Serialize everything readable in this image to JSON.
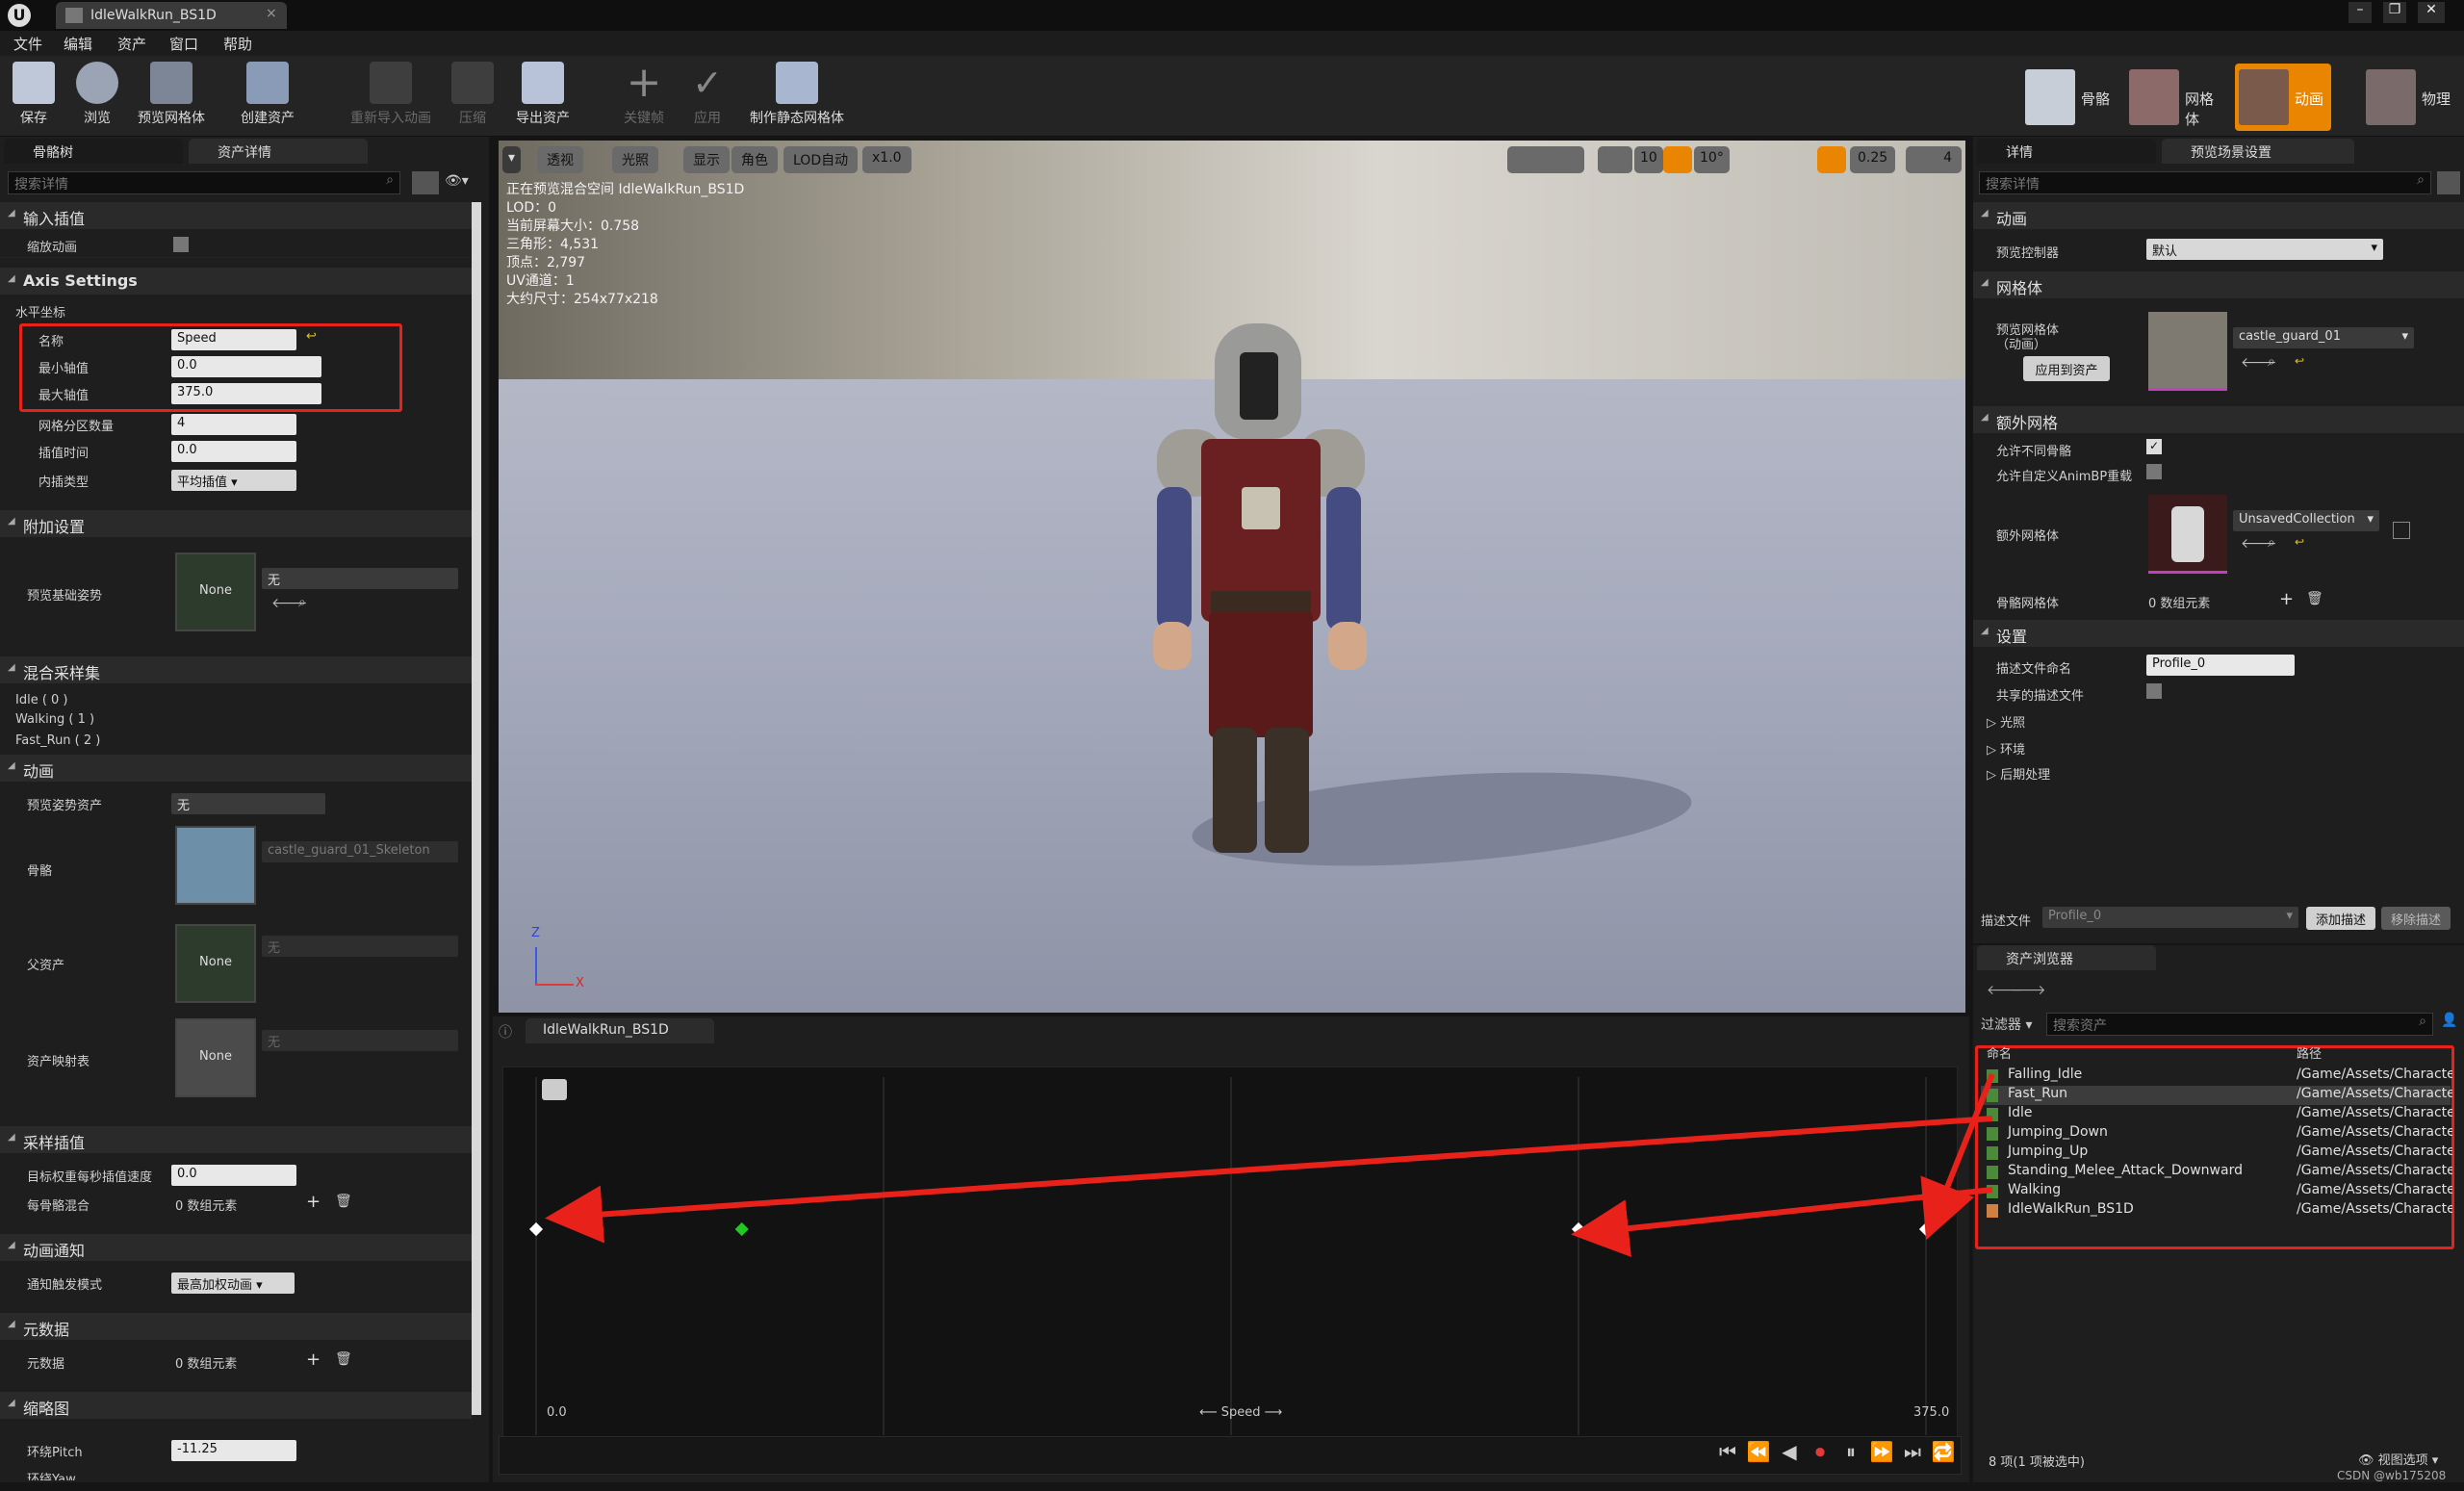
{
  "window": {
    "doc_tab": "IdleWalkRun_BS1D"
  },
  "menu": [
    "文件",
    "编辑",
    "资产",
    "窗口",
    "帮助"
  ],
  "toolbar": {
    "buttons": [
      "保存",
      "浏览",
      "预览网格体",
      "创建资产",
      "重新导入动画",
      "压缩",
      "导出资产",
      "关键帧",
      "应用",
      "制作静态网格体"
    ],
    "modes": [
      "骨骼",
      "网格体",
      "动画",
      "物理"
    ]
  },
  "left": {
    "tabs": [
      "骨骼树",
      "资产详情"
    ],
    "search_placeholder": "搜索详情",
    "sections": {
      "input_interp": "输入插值",
      "axis_settings": "Axis Settings",
      "additive": "附加设置",
      "blend_samples": "混合采样集",
      "animation": "动画",
      "sample_interp": "采样插值",
      "anim_notify": "动画通知",
      "metadata": "元数据",
      "thumbnail": "缩略图"
    },
    "scale_anim": "缩放动画",
    "horizontal_axis": "水平坐标",
    "axis": {
      "name_label": "名称",
      "name_value": "Speed",
      "min_label": "最小轴值",
      "min_value": "0.0",
      "max_label": "最大轴值",
      "max_value": "375.0",
      "grid_label": "网格分区数量",
      "grid_value": "4",
      "interp_time_label": "插值时间",
      "interp_time_value": "0.0",
      "interp_type_label": "内插类型",
      "interp_type_value": "平均插值"
    },
    "preview_base_pose": "预览基础姿势",
    "none": "None",
    "none_cn": "无",
    "samples": [
      "Idle ( 0 )",
      "Walking ( 1 )",
      "Fast_Run ( 2 )"
    ],
    "preview_pose_asset": "预览姿势资产",
    "skeleton_label": "骨骼",
    "skeleton_value": "castle_guard_01_Skeleton",
    "parent_asset": "父资产",
    "asset_mapping": "资产映射表",
    "target_weight_label": "目标权重每秒插值速度",
    "target_weight_value": "0.0",
    "per_bone_label": "每骨骼混合",
    "zero_elements": "0 数组元素",
    "notify_mode_label": "通知触发模式",
    "notify_mode_value": "最高加权动画",
    "metadata_label": "元数据",
    "orbit_pitch_label": "环绕Pitch",
    "orbit_pitch_value": "-11.25",
    "orbit_yaw_label": "环绕Yaw"
  },
  "viewport": {
    "buttons": [
      "透视",
      "光照",
      "显示",
      "角色",
      "LOD自动",
      "x1.0"
    ],
    "snap_values": [
      "10",
      "10°",
      "0.25",
      "4"
    ],
    "info": [
      "正在预览混合空间 IdleWalkRun_BS1D",
      "LOD：0",
      "当前屏幕大小：0.758",
      "三角形：4,531",
      "顶点：2,797",
      "UV通道：1",
      "大约尺寸：254x77x218"
    ],
    "axis_z": "Z",
    "axis_x": "X"
  },
  "blend_editor": {
    "tab": "IdleWalkRun_BS1D",
    "min_label": "0.0",
    "max_label": "375.0",
    "axis_label": "Speed",
    "samples_frac": [
      0.0,
      0.25,
      0.5,
      0.75,
      1.0
    ]
  },
  "right": {
    "tabs": [
      "详情",
      "预览场景设置"
    ],
    "search_placeholder": "搜索详情",
    "sections": {
      "animation": "动画",
      "mesh": "网格体",
      "extra_mesh": "额外网格",
      "settings": "设置"
    },
    "preview_controller_label": "预览控制器",
    "preview_controller_value": "默认",
    "preview_mesh_label": "预览网格体\n（动画）",
    "preview_mesh_value": "castle_guard_01",
    "apply_to_asset": "应用到资产",
    "allow_diff_skel": "允许不同骨骼",
    "allow_custom_animbp": "允许自定义AnimBP重载",
    "extra_mesh_label": "额外网格体",
    "extra_mesh_value": "UnsavedCollection",
    "skeletal_mesh_label": "骨骼网格体",
    "skeletal_mesh_value": "0 数组元素",
    "profile_name_label": "描述文件命名",
    "profile_name_value": "Profile_0",
    "shared_profile": "共享的描述文件",
    "subgroups": [
      "光照",
      "环境",
      "后期处理"
    ],
    "profile_bar": {
      "label": "描述文件",
      "value": "Profile_0",
      "add": "添加描述",
      "remove": "移除描述"
    }
  },
  "asset_browser": {
    "tab": "资产浏览器",
    "filter": "过滤器",
    "search_placeholder": "搜索资产",
    "col_name": "命名",
    "col_path": "路径",
    "assets": [
      {
        "name": "Falling_Idle",
        "path": "/Game/Assets/Characte"
      },
      {
        "name": "Fast_Run",
        "path": "/Game/Assets/Characte"
      },
      {
        "name": "Idle",
        "path": "/Game/Assets/Characte"
      },
      {
        "name": "Jumping_Down",
        "path": "/Game/Assets/Characte"
      },
      {
        "name": "Jumping_Up",
        "path": "/Game/Assets/Characte"
      },
      {
        "name": "Standing_Melee_Attack_Downward",
        "path": "/Game/Assets/Characte"
      },
      {
        "name": "Walking",
        "path": "/Game/Assets/Characte"
      },
      {
        "name": "IdleWalkRun_BS1D",
        "path": "/Game/Assets/Characte"
      }
    ],
    "count": "8 项(1 项被选中)",
    "view_options": "视图选项"
  },
  "watermark": "CSDN @wb175208",
  "colors": {
    "highlight": "#e8221a",
    "accent": "#f08000",
    "selected_row": "#3c3c3c"
  }
}
